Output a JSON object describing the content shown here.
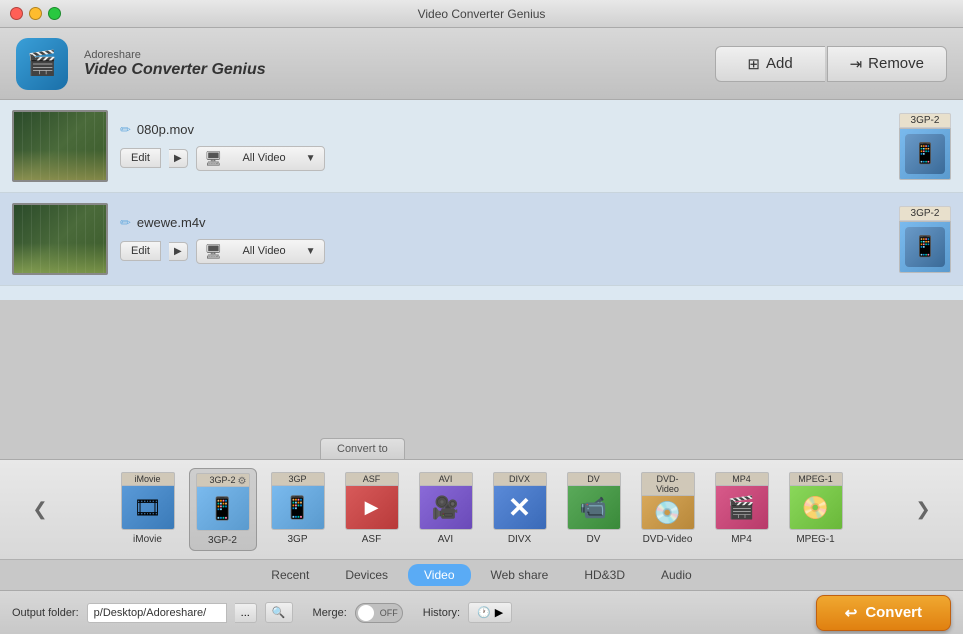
{
  "window": {
    "title": "Video Converter Genius"
  },
  "header": {
    "app_icon": "🎬",
    "app_sub": "Adoreshare",
    "app_name": "Video Converter Genius",
    "add_label": "Add",
    "remove_label": "Remove"
  },
  "files": [
    {
      "name": "080p.mov",
      "format": "3GP-2",
      "edit_label": "Edit",
      "format_selector_label": "All Video"
    },
    {
      "name": "ewewe.m4v",
      "format": "3GP-2",
      "edit_label": "Edit",
      "format_selector_label": "All Video"
    }
  ],
  "convert_to": {
    "tab_label": "Convert to",
    "formats": [
      {
        "id": "imovie",
        "top": "iMovie",
        "label": "iMovie",
        "icon": "🎞",
        "color_class": "fi-imovie",
        "active": false
      },
      {
        "id": "3gp2",
        "top": "3GP-2",
        "label": "3GP-2",
        "icon": "📱",
        "color_class": "fi-3gp2",
        "active": true,
        "gear": true
      },
      {
        "id": "3gp",
        "top": "3GP",
        "label": "3GP",
        "icon": "📱",
        "color_class": "fi-3gp",
        "active": false
      },
      {
        "id": "asf",
        "top": "ASF",
        "label": "ASF",
        "icon": "▶",
        "color_class": "fi-asf",
        "active": false
      },
      {
        "id": "avi",
        "top": "AVI",
        "label": "AVI",
        "icon": "🎥",
        "color_class": "fi-avi",
        "active": false
      },
      {
        "id": "divx",
        "top": "DIVX",
        "label": "DIVX",
        "icon": "✕",
        "color_class": "fi-divx",
        "active": false
      },
      {
        "id": "dv",
        "top": "DV",
        "label": "DV",
        "icon": "📹",
        "color_class": "fi-dv",
        "active": false
      },
      {
        "id": "dvd",
        "top": "DVD-Video",
        "label": "DVD-Video",
        "icon": "💿",
        "color_class": "fi-dvd",
        "active": false
      },
      {
        "id": "mp4",
        "top": "MP4",
        "label": "MP4",
        "icon": "🎬",
        "color_class": "fi-mp4",
        "active": false
      },
      {
        "id": "mpeg1",
        "top": "MPEG-1",
        "label": "MPEG-1",
        "icon": "📀",
        "color_class": "fi-mpeg1",
        "active": false
      }
    ]
  },
  "tabs": [
    {
      "id": "recent",
      "label": "Recent",
      "active": false
    },
    {
      "id": "devices",
      "label": "Devices",
      "active": false
    },
    {
      "id": "video",
      "label": "Video",
      "active": true
    },
    {
      "id": "webshare",
      "label": "Web share",
      "active": false
    },
    {
      "id": "hd3d",
      "label": "HD&3D",
      "active": false
    },
    {
      "id": "audio",
      "label": "Audio",
      "active": false
    }
  ],
  "bottom": {
    "output_label": "Output folder:",
    "output_path": "p/Desktop/Adoreshare/",
    "browse_label": "...",
    "search_icon": "🔍",
    "merge_label": "Merge:",
    "toggle_state": "OFF",
    "history_label": "History:",
    "history_icon": "🕐",
    "history_arrow": "▶",
    "convert_label": "Convert",
    "convert_icon": "↩"
  }
}
